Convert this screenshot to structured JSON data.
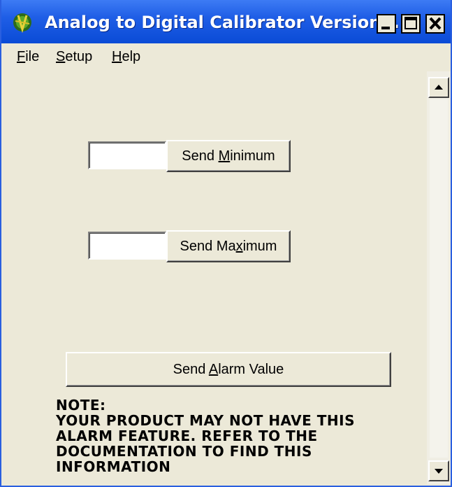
{
  "window": {
    "title": "Analog to Digital Calibrator Version ..."
  },
  "menu": {
    "file": {
      "accel": "F",
      "rest": "ile"
    },
    "setup": {
      "accel": "S",
      "rest": "etup"
    },
    "help": {
      "accel": "H",
      "rest": "elp"
    }
  },
  "controls": {
    "minimum": {
      "value": "",
      "button": {
        "pre": "Send ",
        "accel": "M",
        "post": "inimum"
      }
    },
    "maximum": {
      "value": "",
      "button": {
        "pre": "Send Ma",
        "accel": "x",
        "post": "imum"
      }
    },
    "alarm": {
      "button": {
        "pre": "Send ",
        "accel": "A",
        "post": "larm Value"
      }
    }
  },
  "note": {
    "text": "NOTE:\nYOUR PRODUCT MAY NOT HAVE THIS\nALARM FEATURE. REFER TO THE\nDOCUMENTATION TO FIND THIS\nINFORMATION"
  },
  "icons": {
    "app": "calibrator-app-icon",
    "minimize": "minimize-icon",
    "maximize": "maximize-icon",
    "close": "close-icon",
    "scroll_up": "scroll-up-arrow-icon",
    "scroll_down": "scroll-down-arrow-icon"
  },
  "colors": {
    "titlebar": "#1f5ee6",
    "window_bg": "#ece9d8"
  }
}
